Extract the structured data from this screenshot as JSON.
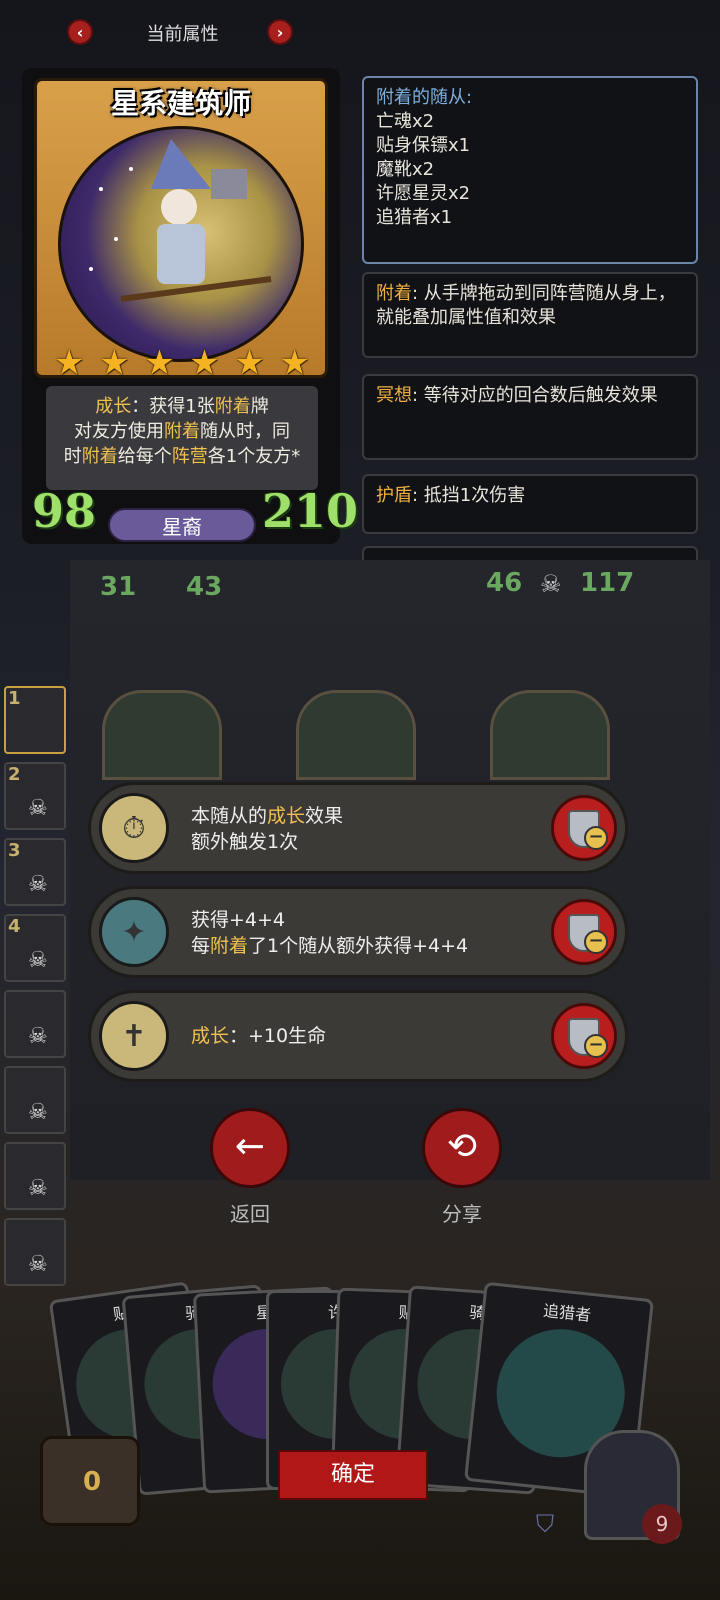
{
  "top_bar": {
    "title": "当前属性"
  },
  "hero": {
    "name": "星系建筑师",
    "stars": 6,
    "desc_line1_a": "成长",
    "desc_line1_b": "：获得1张",
    "desc_line1_c": "附着",
    "desc_line1_d": "牌",
    "desc_line2_a": "对友方使用",
    "desc_line2_b": "附着",
    "desc_line2_c": "随从时，同",
    "desc_line3_a": "时",
    "desc_line3_b": "附着",
    "desc_line3_c": "给每个",
    "desc_line3_d": "阵营",
    "desc_line3_e": "各1个友方*",
    "attack": "98",
    "health": "210",
    "tribe": "星裔"
  },
  "panels": {
    "attached_title": "附着的随从:",
    "attached_items": [
      "亡魂x2",
      "贴身保镖x1",
      "魔靴x2",
      "许愿星灵x2",
      "追猎者x1"
    ],
    "attach_kw": "附着",
    "attach_text": ": 从手牌拖动到同阵营随从身上，就能叠加属性值和效果",
    "meditate_kw": "冥想",
    "meditate_text": ": 等待对应的回合数后触发效果",
    "shield_kw": "护盾",
    "shield_text": ": 抵挡1次伤害"
  },
  "board_stats": {
    "left_atk": "31",
    "left_hp": "43",
    "right_atk": "46",
    "right_hp": "117"
  },
  "sidebar": {
    "slots": [
      "1",
      "2",
      "3",
      "4",
      "",
      "",
      "",
      ""
    ]
  },
  "effects": [
    {
      "line1_a": "本随从的",
      "line1_b": "成长",
      "line1_c": "效果",
      "line2": "额外触发1次"
    },
    {
      "line1": "获得+4+4",
      "line2_a": "每",
      "line2_b": "附着",
      "line2_c": "了1个随从额外获得+4+4"
    },
    {
      "kw": "成长",
      "text": "：+10生命"
    }
  ],
  "actions": {
    "back_label": "返回",
    "share_label": "分享"
  },
  "hand": {
    "cards": [
      "贴",
      "骑",
      "星",
      "许",
      "贴",
      "骑",
      "追猎者"
    ],
    "confirm": "确定",
    "gold": "0",
    "hero_hp": "9"
  }
}
